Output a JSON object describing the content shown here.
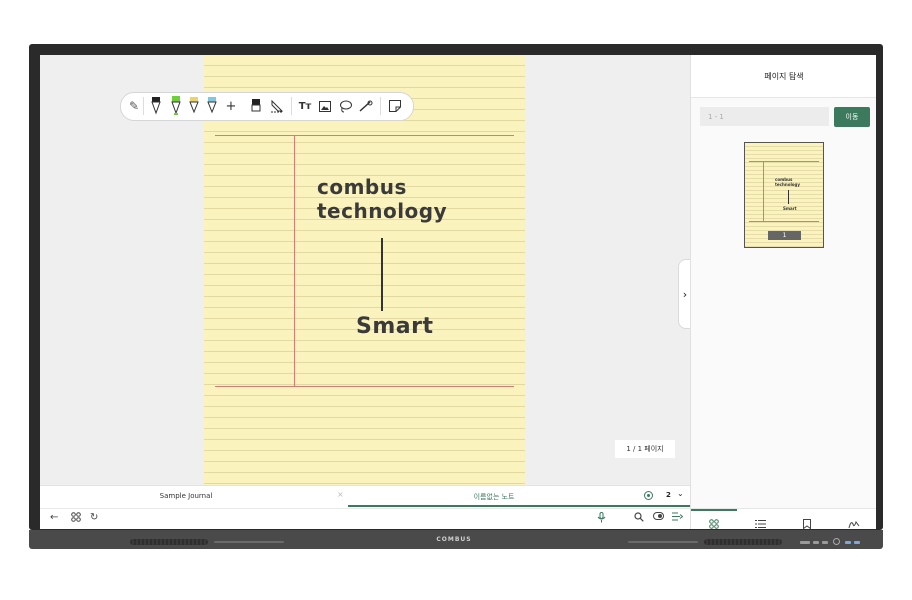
{
  "device": {
    "brand": "COMBUS"
  },
  "toolbar": {
    "tools": [
      {
        "name": "pencil-icon",
        "glyph": "✎"
      },
      {
        "name": "pen-black-icon",
        "glyph": "▽"
      },
      {
        "name": "pen-green-icon",
        "glyph": "▽"
      },
      {
        "name": "highlighter-yellow-icon",
        "glyph": "▽"
      },
      {
        "name": "highlighter-blue-icon",
        "glyph": "▽"
      },
      {
        "name": "add-pen-icon",
        "glyph": "+"
      },
      {
        "name": "eraser-icon",
        "glyph": "▮"
      },
      {
        "name": "area-eraser-icon",
        "glyph": "◸"
      },
      {
        "name": "text-icon",
        "glyph": "Tт"
      },
      {
        "name": "image-icon",
        "glyph": "▣"
      },
      {
        "name": "lasso-icon",
        "glyph": "◌"
      },
      {
        "name": "pointer-icon",
        "glyph": "⌖"
      },
      {
        "name": "sticky-note-icon",
        "glyph": "◱"
      }
    ]
  },
  "canvas": {
    "line1": "combus",
    "line2": "technology",
    "line3": "Smart",
    "page_indicator": "1 / 1 페이지"
  },
  "tabs": [
    {
      "label": "Sample Journal",
      "active": false
    },
    {
      "label": "이름없는 노트",
      "active": true
    }
  ],
  "tab_page_count": "2",
  "side_panel": {
    "title": "페이지 탐색",
    "range_placeholder": "1 - 1",
    "go_label": "이동",
    "thumbnail_page": "1",
    "thumb_line1": "combus",
    "thumb_line2": "technology",
    "thumb_line3": "Smart"
  },
  "colors": {
    "accent": "#3c7a5d",
    "paper": "#fbf3be",
    "margin_line": "#d97b73",
    "pen_green": "#6fcf3a",
    "highlighter_yellow": "#e9d46b",
    "highlighter_blue": "#7fc8e0"
  }
}
